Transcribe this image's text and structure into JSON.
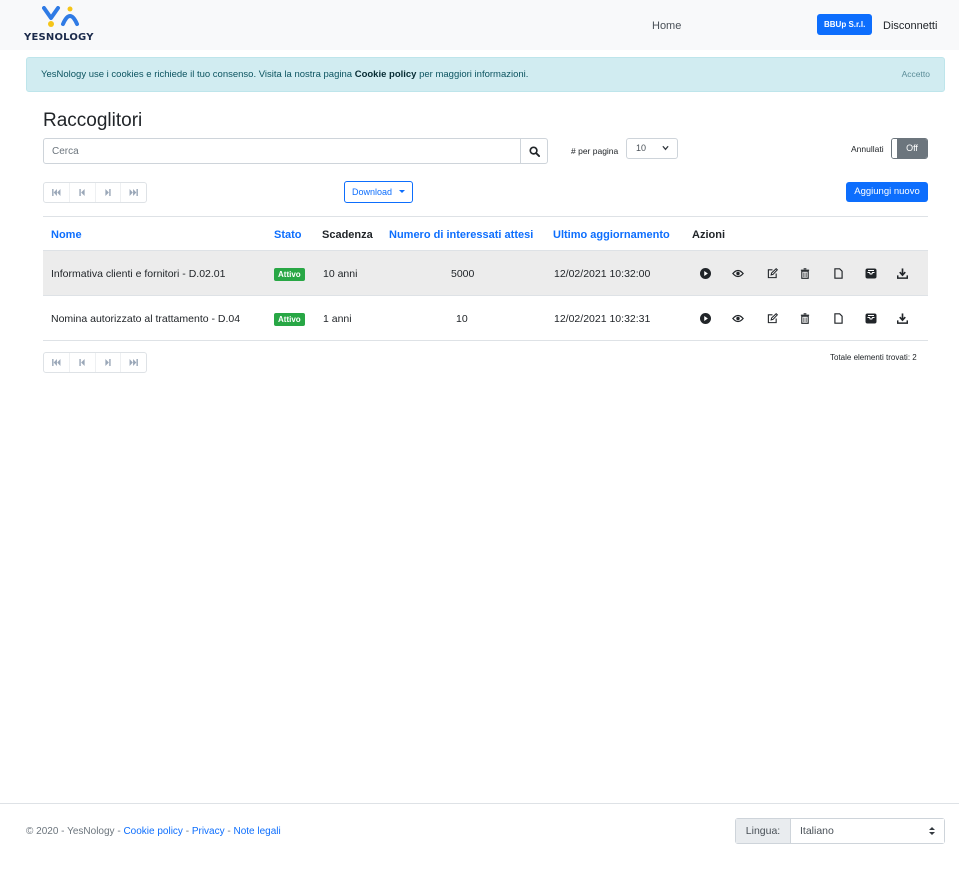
{
  "header": {
    "brand": "YESNOLOGY",
    "nav_home": "Home",
    "company": "BBUp S.r.l.",
    "logout": "Disconnetti"
  },
  "cookie": {
    "text_before": "YesNology use i cookies e richiede il tuo consenso. Visita la nostra pagina ",
    "link": "Cookie policy",
    "text_after": " per maggiori informazioni.",
    "accept": "Accetto"
  },
  "page": {
    "title": "Raccoglitori",
    "search_placeholder": "Cerca",
    "per_page_label": "# per pagina",
    "per_page_value": "10",
    "toggle_label": "Annullati",
    "toggle_state": "Off",
    "download_label": "Download",
    "add_label": "Aggiungi nuovo",
    "total_text": "Totale elementi trovati: 2"
  },
  "table": {
    "headers": [
      "Nome",
      "Stato",
      "Scadenza",
      "Numero di interessati attesi",
      "Ultimo aggiornamento",
      "Azioni"
    ],
    "rows": [
      {
        "nome": "Informativa clienti e fornitori - D.02.01",
        "stato": "Attivo",
        "scadenza": "10 anni",
        "interessati": "5000",
        "aggiornamento": "12/02/2021 10:32:00"
      },
      {
        "nome": "Nomina autorizzato al trattamento - D.04",
        "stato": "Attivo",
        "scadenza": "1 anni",
        "interessati": "10",
        "aggiornamento": "12/02/2021 10:32:31"
      }
    ],
    "actions": [
      "play-icon",
      "eye-icon",
      "edit-icon",
      "trash-icon",
      "file-icon",
      "inbox-icon",
      "download-icon"
    ]
  },
  "footer": {
    "copyright": "© 2020 - YesNology - ",
    "cookie_link": "Cookie policy",
    "sep": " - ",
    "privacy_link": "Privacy",
    "legal_link": "Note legali",
    "lang_label": "Lingua:",
    "lang_value": "Italiano"
  },
  "colors": {
    "primary": "#0d6efd",
    "success": "#28a745",
    "alert_bg": "#d1ecf1",
    "logo_blue": "#2f7be5",
    "logo_yellow": "#f5c518"
  }
}
